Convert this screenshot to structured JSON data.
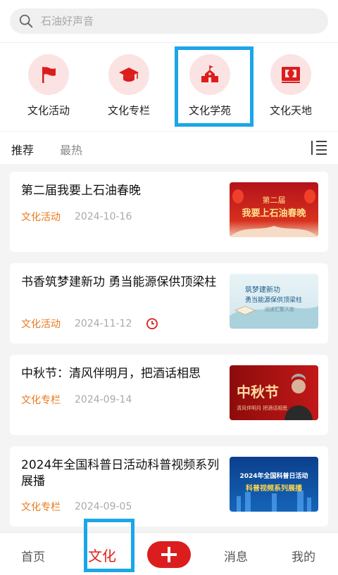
{
  "search": {
    "placeholder": "石油好声音"
  },
  "categories": [
    {
      "label": "文化活动",
      "icon": "flag-icon"
    },
    {
      "label": "文化专栏",
      "icon": "graduation-cap-icon"
    },
    {
      "label": "文化学苑",
      "icon": "school-building-icon"
    },
    {
      "label": "文化天地",
      "icon": "book-icon"
    }
  ],
  "tabs": [
    {
      "label": "推荐"
    },
    {
      "label": "最热"
    }
  ],
  "articles": [
    {
      "title": "第二届我要上石油春晚",
      "tag": "文化活动",
      "date": "2024-10-16",
      "thumb": {
        "line1": "第二届",
        "line2": "我要上石油春晚"
      }
    },
    {
      "title": "书香筑梦建新功 勇当能源保供顶梁柱",
      "tag": "文化活动",
      "date": "2024-11-12",
      "thumb": {
        "line1": "筑梦建新功",
        "line2": "勇当能源保供顶梁柱",
        "line3": "阅读汇集人类"
      }
    },
    {
      "title": "中秋节：清风伴明月，把酒话相思",
      "tag": "文化专栏",
      "date": "2024-09-14",
      "thumb": {
        "line1": "中秋节",
        "line2": "清风伴明月 把酒话相思"
      }
    },
    {
      "title": "2024年全国科普日活动科普视频系列展播",
      "tag": "文化专栏",
      "date": "2024-09-05",
      "thumb": {
        "line1": "2024年全国科普日活动",
        "line2": "科普视频系列展播"
      }
    }
  ],
  "bottom_nav": [
    {
      "label": "首页"
    },
    {
      "label": "文化"
    },
    {
      "label": "消息"
    },
    {
      "label": "我的"
    }
  ],
  "colors": {
    "accent": "#dc1d1d",
    "tag": "#e8781c",
    "highlight": "#1ba6e8"
  }
}
